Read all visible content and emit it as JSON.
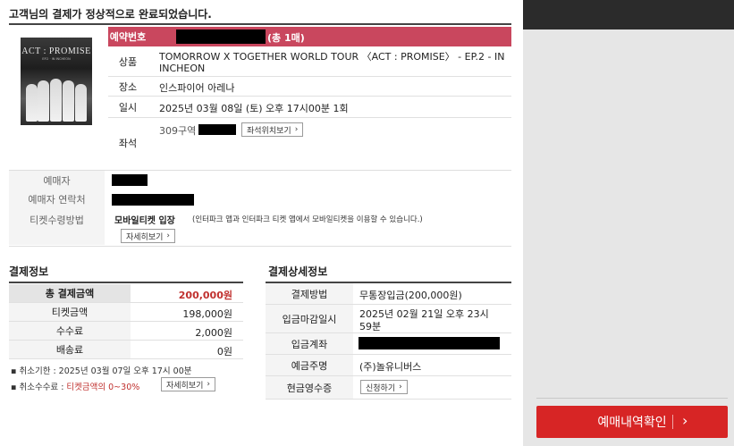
{
  "page_title": "고객님의 결제가 정상적으로 완료되었습니다.",
  "poster": {
    "title": "ACT : PROMISE",
    "subtitle": "EP.2 · IN INCHEON"
  },
  "reservation": {
    "label": "예약번호",
    "count_text": "(총 1매)"
  },
  "product": {
    "label": "상품",
    "value_line1": "TOMORROW X TOGETHER WORLD TOUR 〈ACT : PROMISE〉 - EP.2 - IN",
    "value_line2": "INCHEON"
  },
  "venue": {
    "label": "장소",
    "value": "인스파이어 아레나"
  },
  "datetime": {
    "label": "일시",
    "value": "2025년 03월 08일 (토) 오후 17시00분 1회"
  },
  "seat": {
    "label": "좌석",
    "value_prefix": "309구역",
    "view_button": "좌석위치보기"
  },
  "buyer": {
    "name_label": "예매자",
    "contact_label": "예매자 연락처",
    "delivery_label": "티켓수령방법",
    "delivery_method": "모바일티켓 입장",
    "delivery_desc": "(인터파크 앱과 인터파크 티켓 앱에서 모바일티켓을 이용할 수 있습니다.)",
    "detail_button": "자세히보기"
  },
  "payment": {
    "title": "결제정보",
    "rows": [
      {
        "label": "총 결제금액",
        "amount": "200,000원"
      },
      {
        "label": "티켓금액",
        "amount": "198,000원"
      },
      {
        "label": "수수료",
        "amount": "2,000원"
      },
      {
        "label": "배송료",
        "amount": "0원"
      }
    ],
    "cancel_deadline": "취소기한 : 2025년 03월 07일 오후 17시 00분",
    "cancel_fee_prefix": "취소수수료 : ",
    "cancel_fee_value": "티켓금액의 0~30%",
    "cancel_fee_button": "자세히보기"
  },
  "payment_detail": {
    "title": "결제상세정보",
    "method_label": "결제방법",
    "method_value": "무통장입금(200,000원)",
    "deadline_label": "입금마감일시",
    "deadline_line1": "2025년 02월 21일 오후 23시",
    "deadline_line2": "59분",
    "account_label": "입금계좌",
    "holder_label": "예금주명",
    "holder_value": "(주)놀유니버스",
    "receipt_label": "현금영수증",
    "receipt_button": "신청하기"
  },
  "cta": {
    "label": "예매내역확인",
    "arrow": "›"
  },
  "colors": {
    "accent": "#c9475e",
    "cta": "#d72525",
    "amount_red": "#c0302e"
  }
}
